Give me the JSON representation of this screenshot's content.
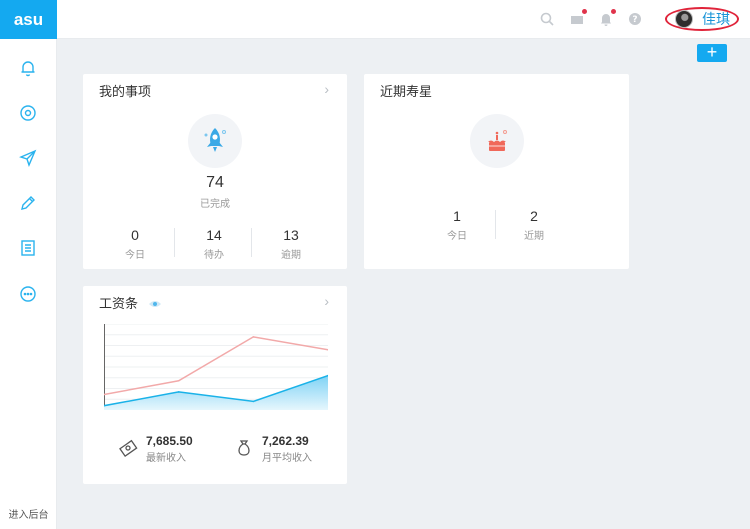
{
  "app": {
    "logo_text": "asu"
  },
  "sidebar": {
    "items": [
      {
        "icon": "bell-icon"
      },
      {
        "icon": "target-icon"
      },
      {
        "icon": "send-icon"
      },
      {
        "icon": "pencil-icon"
      },
      {
        "icon": "document-icon"
      },
      {
        "icon": "more-icon"
      }
    ],
    "backend_label": "进入后台"
  },
  "topbar": {
    "icons": [
      "search-icon",
      "message-icon",
      "bell-icon",
      "help-icon"
    ],
    "user_name": "佳琪",
    "add_label": "+"
  },
  "colors": {
    "accent": "#14a9f0",
    "rocket": "#3aa9e6",
    "cake": "#f0685a",
    "salary_line_high": "#f2a9a9",
    "salary_line_low": "#1ab2e8"
  },
  "my_tasks": {
    "title": "我的事项",
    "completed_count": "74",
    "completed_label": "已完成",
    "stats": [
      {
        "value": "0",
        "label": "今日"
      },
      {
        "value": "14",
        "label": "待办"
      },
      {
        "value": "13",
        "label": "逾期"
      }
    ]
  },
  "birthdays": {
    "title": "近期寿星",
    "stats": [
      {
        "value": "1",
        "label": "今日"
      },
      {
        "value": "2",
        "label": "近期"
      }
    ]
  },
  "payslip": {
    "title": "工资条",
    "latest_amount": "7,685.50",
    "latest_label": "最新收入",
    "avg_amount": "7,262.39",
    "avg_label": "月平均收入"
  },
  "chart_data": {
    "type": "area",
    "title": "",
    "xlabel": "",
    "ylabel": "",
    "x": [
      1,
      2,
      3,
      4
    ],
    "series": [
      {
        "values": [
          0.18,
          0.34,
          0.85,
          0.7
        ]
      },
      {
        "values": [
          0.05,
          0.21,
          0.1,
          0.4
        ]
      }
    ],
    "ylim": [
      0,
      1
    ],
    "grid": true
  }
}
